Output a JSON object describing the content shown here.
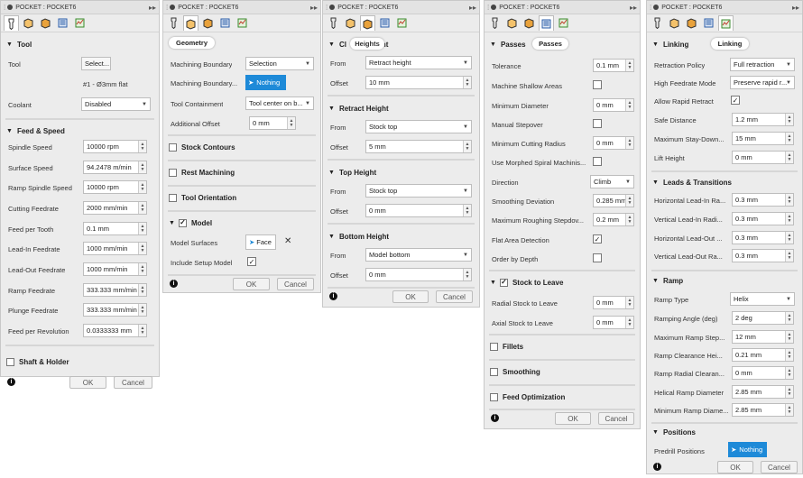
{
  "panel1": {
    "title": "POCKET : POCKET6",
    "tool_section": "Tool",
    "tool_label": "Tool",
    "tool_select": "Select...",
    "tool_name": "#1 - Ø3mm flat",
    "coolant_label": "Coolant",
    "coolant_value": "Disabled",
    "feed_section": "Feed & Speed",
    "rows": [
      {
        "label": "Spindle Speed",
        "value": "10000 rpm"
      },
      {
        "label": "Surface Speed",
        "value": "94.2478 m/min"
      },
      {
        "label": "Ramp Spindle Speed",
        "value": "10000 rpm"
      },
      {
        "label": "Cutting Feedrate",
        "value": "2000 mm/min"
      },
      {
        "label": "Feed per Tooth",
        "value": "0.1 mm"
      },
      {
        "label": "Lead-In Feedrate",
        "value": "1000 mm/min"
      },
      {
        "label": "Lead-Out Feedrate",
        "value": "1000 mm/min"
      },
      {
        "label": "Ramp Feedrate",
        "value": "333.333 mm/min"
      },
      {
        "label": "Plunge Feedrate",
        "value": "333.333 mm/min"
      },
      {
        "label": "Feed per Revolution",
        "value": "0.0333333 mm"
      }
    ],
    "shaft_section": "Shaft & Holder",
    "ok": "OK",
    "cancel": "Cancel"
  },
  "panel2": {
    "title": "POCKET : POCKET6",
    "tooltip": "Geometry",
    "machining_boundary_label": "Machining Boundary",
    "machining_boundary_value": "Selection",
    "machining_boundary2_label": "Machining Boundary...",
    "nothing": "Nothing",
    "tool_containment_label": "Tool Containment",
    "tool_containment_value": "Tool center on b...",
    "additional_offset_label": "Additional Offset",
    "additional_offset_value": "0 mm",
    "stock_contours": "Stock Contours",
    "rest_machining": "Rest Machining",
    "tool_orientation": "Tool Orientation",
    "model_section": "Model",
    "model_surfaces_label": "Model Surfaces",
    "face": "Face",
    "include_setup_label": "Include Setup Model",
    "ok": "OK",
    "cancel": "Cancel"
  },
  "panel3": {
    "title": "POCKET : POCKET6",
    "tooltip": "Heights",
    "clearance_section_a": "Cl",
    "clearance_section_b": "ght",
    "from_label": "From",
    "offset_label": "Offset",
    "clearance_from": "Retract height",
    "clearance_offset": "10 mm",
    "retract_section": "Retract Height",
    "retract_from": "Stock top",
    "retract_offset": "5 mm",
    "top_section": "Top Height",
    "top_from": "Stock top",
    "top_offset": "0 mm",
    "bottom_section": "Bottom Height",
    "bottom_from": "Model bottom",
    "bottom_offset": "0 mm",
    "ok": "OK",
    "cancel": "Cancel"
  },
  "panel4": {
    "title": "POCKET : POCKET6",
    "passes_section": "Passes",
    "tooltip": "Passes",
    "tolerance_label": "Tolerance",
    "tolerance_value": "0.1 mm",
    "machine_shallow_label": "Machine Shallow Areas",
    "min_diameter_label": "Minimum Diameter",
    "min_diameter_value": "0 mm",
    "manual_stepover_label": "Manual Stepover",
    "min_cutting_radius_label": "Minimum Cutting Radius",
    "min_cutting_radius_value": "0 mm",
    "morphed_spiral_label": "Use Morphed Spiral Machinis...",
    "direction_label": "Direction",
    "direction_value": "Climb",
    "smoothing_label": "Smoothing Deviation",
    "smoothing_value": "0.285 mm",
    "max_roughing_label": "Maximum Roughing Stepdov...",
    "max_roughing_value": "0.2 mm",
    "flat_area_label": "Flat Area Detection",
    "order_depth_label": "Order by Depth",
    "stock_to_leave_section": "Stock to Leave",
    "radial_label": "Radial Stock to Leave",
    "radial_value": "0 mm",
    "axial_label": "Axial Stock to Leave",
    "axial_value": "0 mm",
    "fillets": "Fillets",
    "smoothing": "Smoothing",
    "feed_optimization": "Feed Optimization",
    "ok": "OK",
    "cancel": "Cancel"
  },
  "panel5": {
    "title": "POCKET : POCKET6",
    "linking_section": "Linking",
    "tooltip": "Linking",
    "retraction_policy_label": "Retraction Policy",
    "retraction_policy_value": "Full retraction",
    "high_feedrate_label": "High Feedrate Mode",
    "high_feedrate_value": "Preserve rapid r...",
    "allow_rapid_label": "Allow Rapid Retract",
    "safe_distance_label": "Safe Distance",
    "safe_distance_value": "1.2 mm",
    "max_stay_down_label": "Maximum Stay-Down...",
    "max_stay_down_value": "15 mm",
    "lift_height_label": "Lift Height",
    "lift_height_value": "0 mm",
    "leads_section": "Leads & Transitions",
    "h_lead_in_label": "Horizontal Lead-In Ra...",
    "h_lead_in_value": "0.3 mm",
    "v_lead_in_label": "Vertical Lead-In Radi...",
    "v_lead_in_value": "0.3 mm",
    "h_lead_out_label": "Horizontal Lead-Out ...",
    "h_lead_out_value": "0.3 mm",
    "v_lead_out_label": "Vertical Lead-Out Ra...",
    "v_lead_out_value": "0.3 mm",
    "ramp_section": "Ramp",
    "ramp_type_label": "Ramp Type",
    "ramp_type_value": "Helix",
    "ramping_angle_label": "Ramping Angle (deg)",
    "ramping_angle_value": "2 deg",
    "max_ramp_step_label": "Maximum Ramp Step...",
    "max_ramp_step_value": "12 mm",
    "ramp_clearance_label": "Ramp Clearance Hei...",
    "ramp_clearance_value": "0.21 mm",
    "ramp_radial_label": "Ramp Radial Clearan...",
    "ramp_radial_value": "0 mm",
    "helical_ramp_label": "Helical Ramp Diameter",
    "helical_ramp_value": "2.85 mm",
    "min_ramp_label": "Minimum Ramp Diame...",
    "min_ramp_value": "2.85 mm",
    "positions_section": "Positions",
    "predrill_label": "Predrill Positions",
    "nothing": "Nothing",
    "ok": "OK",
    "cancel": "Cancel"
  }
}
